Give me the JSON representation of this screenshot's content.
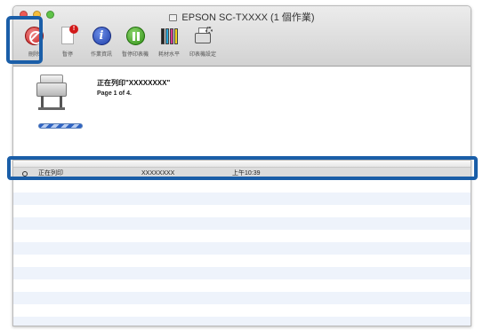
{
  "window": {
    "title": "EPSON SC-TXXXX (1 個作業)"
  },
  "toolbar": {
    "items": [
      {
        "label": "刪除",
        "icon": "delete-icon"
      },
      {
        "label": "暫停",
        "icon": "hold-icon"
      },
      {
        "label": "作業資訊",
        "icon": "info-icon"
      },
      {
        "label": "暫停印表機",
        "icon": "pause-printer-icon"
      },
      {
        "label": "耗材水平",
        "icon": "supply-levels-icon"
      },
      {
        "label": "印表機設定",
        "icon": "printer-settings-icon"
      }
    ]
  },
  "job": {
    "title": "正在列印\"XXXXXXXX\"",
    "pages": "Page 1 of 4."
  },
  "list": {
    "rows": [
      {
        "status": "正在列印",
        "name": "XXXXXXXX",
        "time": "上午10:39"
      }
    ]
  },
  "colors": {
    "highlight": "#1a5ea8",
    "stripe": "#eef3fb",
    "progress": "#2f64c4"
  }
}
